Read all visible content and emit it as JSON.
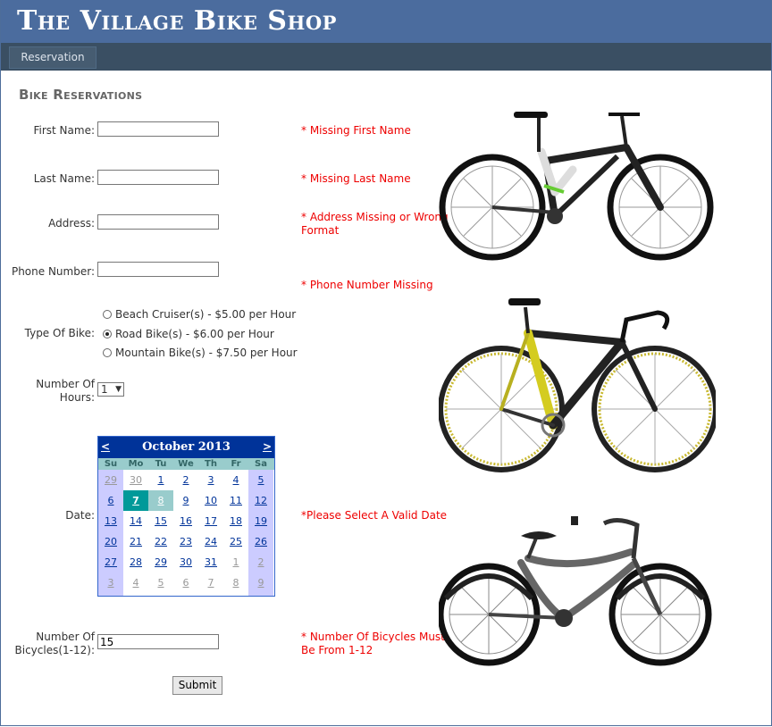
{
  "site": {
    "title": "The Village Bike Shop"
  },
  "menu": {
    "items": [
      {
        "label": "Reservation"
      }
    ]
  },
  "page": {
    "heading": "Bike Reservations"
  },
  "form": {
    "first_name": {
      "label": "First Name:",
      "value": "",
      "error": "* Missing First Name"
    },
    "last_name": {
      "label": "Last Name:",
      "value": "",
      "error": "* Missing Last Name"
    },
    "address": {
      "label": "Address:",
      "value": "",
      "error_line1": "* Address Missing or Wrong",
      "error_line2": "Format"
    },
    "phone": {
      "label": "Phone Number:",
      "value": "",
      "error": "* Phone Number Missing"
    },
    "bike_type": {
      "label": "Type Of Bike:",
      "options": [
        {
          "label": "Beach Cruiser(s) - $5.00 per Hour",
          "selected": false
        },
        {
          "label": "Road Bike(s) - $6.00 per Hour",
          "selected": true
        },
        {
          "label": "Mountain Bike(s) - $7.50 per Hour",
          "selected": false
        }
      ]
    },
    "hours": {
      "label_line1": "Number Of",
      "label_line2": "Hours:",
      "value": "1"
    },
    "date": {
      "label": "Date:",
      "error": "*Please Select A Valid Date",
      "calendar": {
        "title": "October 2013",
        "prev": "<",
        "next": ">",
        "weekdays": [
          "Su",
          "Mo",
          "Tu",
          "We",
          "Th",
          "Fr",
          "Sa"
        ],
        "weeks": [
          [
            "29",
            "30",
            "1",
            "2",
            "3",
            "4",
            "5"
          ],
          [
            "6",
            "7",
            "8",
            "9",
            "10",
            "11",
            "12"
          ],
          [
            "13",
            "14",
            "15",
            "16",
            "17",
            "18",
            "19"
          ],
          [
            "20",
            "21",
            "22",
            "23",
            "24",
            "25",
            "26"
          ],
          [
            "27",
            "28",
            "29",
            "30",
            "31",
            "1",
            "2"
          ],
          [
            "3",
            "4",
            "5",
            "6",
            "7",
            "8",
            "9"
          ]
        ],
        "selected_day": "7",
        "today_day": "8"
      }
    },
    "bicycles": {
      "label_line1": "Number Of",
      "label_line2": "Bicycles(1-12):",
      "value": "15",
      "error_line1": "* Number Of Bicycles Must",
      "error_line2": "Be From 1-12"
    },
    "submit_label": "Submit"
  },
  "colors": {
    "banner": "#4b6c9e",
    "menubar": "#3a4f63",
    "error": "#e00000",
    "calendar_header": "#003399",
    "calendar_selected": "#009999"
  }
}
